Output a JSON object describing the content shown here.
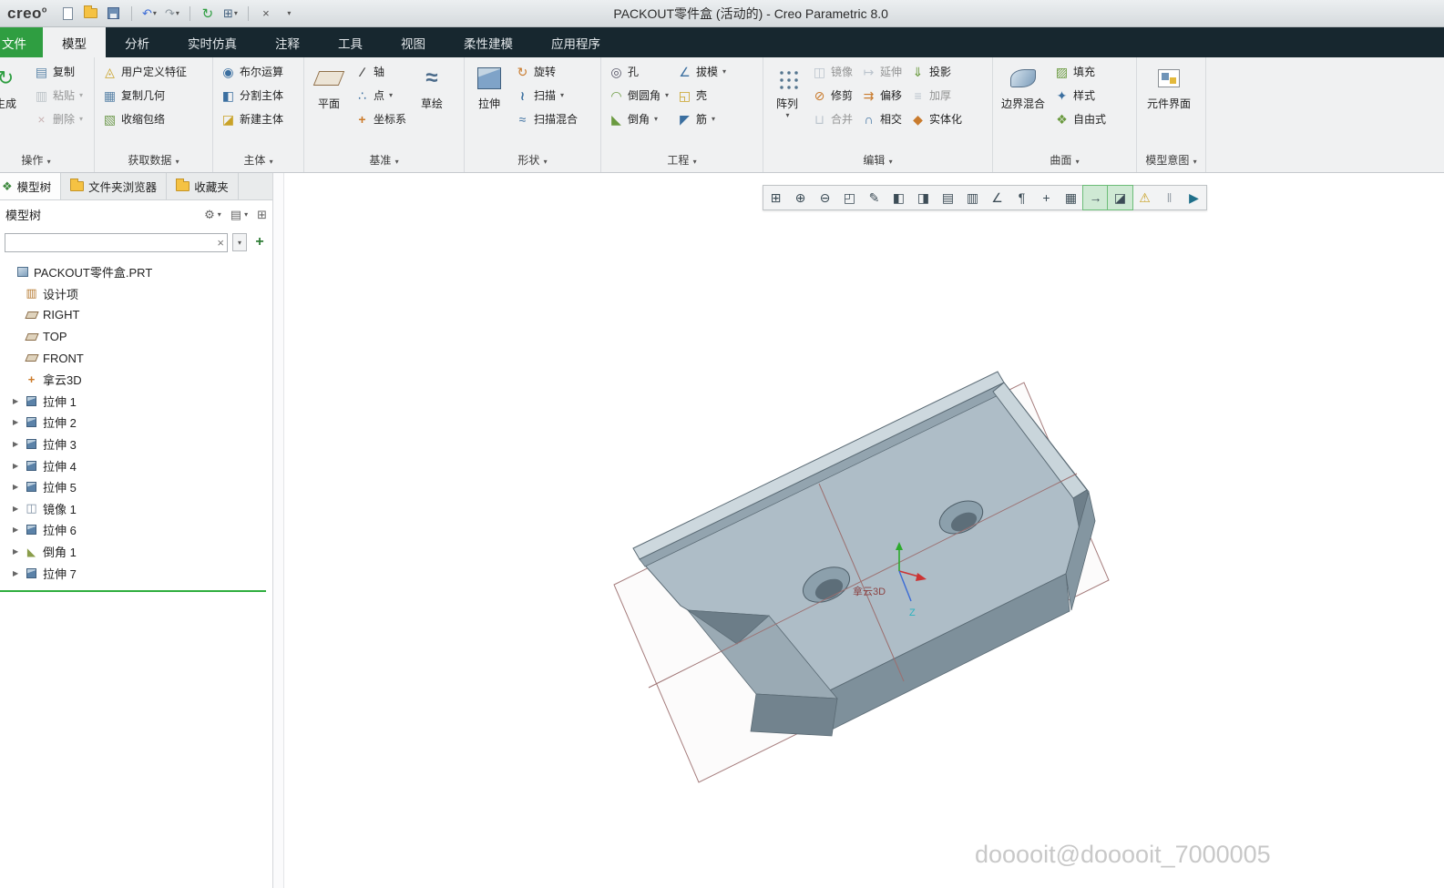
{
  "titlebar": {
    "logo": "creo",
    "title": "PACKOUT零件盒 (活动的) - Creo Parametric 8.0"
  },
  "tabs": {
    "file": "文件",
    "items": [
      "模型",
      "分析",
      "实时仿真",
      "注释",
      "工具",
      "视图",
      "柔性建模",
      "应用程序"
    ],
    "active": "模型"
  },
  "ribbon": {
    "groups": [
      {
        "label": "操作",
        "big": {
          "label": "生成",
          "icon": "regenerate-icon"
        },
        "small": [
          {
            "label": "复制",
            "icon": "copy-icon"
          },
          {
            "label": "粘贴",
            "icon": "paste-icon",
            "dropdown": true,
            "disabled": true
          },
          {
            "label": "删除",
            "icon": "delete-icon",
            "dropdown": true,
            "disabled": true
          }
        ]
      },
      {
        "label": "获取数据",
        "small": [
          {
            "label": "用户定义特征",
            "icon": "udf-icon"
          },
          {
            "label": "复制几何",
            "icon": "copy-geometry-icon"
          },
          {
            "label": "收缩包络",
            "icon": "shrinkwrap-icon"
          }
        ]
      },
      {
        "label": "主体",
        "small": [
          {
            "label": "布尔运算",
            "icon": "boolean-icon"
          },
          {
            "label": "分割主体",
            "icon": "split-body-icon"
          },
          {
            "label": "新建主体",
            "icon": "new-body-icon"
          }
        ]
      },
      {
        "label": "基准",
        "big": {
          "label": "平面",
          "icon": "datum-plane-icon"
        },
        "small": [
          {
            "label": "轴",
            "icon": "axis-icon"
          },
          {
            "label": "点",
            "icon": "point-icon",
            "dropdown": true
          },
          {
            "label": "坐标系",
            "icon": "csys-icon"
          }
        ],
        "big2": {
          "label": "草绘",
          "icon": "sketch-icon"
        }
      },
      {
        "label": "形状",
        "big": {
          "label": "拉伸",
          "icon": "extrude-icon"
        },
        "small": [
          {
            "label": "旋转",
            "icon": "revolve-icon"
          },
          {
            "label": "扫描",
            "icon": "sweep-icon",
            "dropdown": true
          },
          {
            "label": "扫描混合",
            "icon": "swept-blend-icon"
          }
        ]
      },
      {
        "label": "工程",
        "small": [
          {
            "label": "孔",
            "icon": "hole-icon"
          },
          {
            "label": "倒圆角",
            "icon": "round-icon",
            "dropdown": true
          },
          {
            "label": "倒角",
            "icon": "chamfer-icon",
            "dropdown": true
          }
        ],
        "small2": [
          {
            "label": "拔模",
            "icon": "draft-icon",
            "dropdown": true
          },
          {
            "label": "壳",
            "icon": "shell-icon"
          },
          {
            "label": "筋",
            "icon": "rib-icon",
            "dropdown": true
          }
        ]
      },
      {
        "label": "编辑",
        "big": {
          "label": "阵列",
          "icon": "pattern-icon",
          "dropdown": true
        },
        "small": [
          {
            "label": "镜像",
            "icon": "mirror-icon",
            "disabled": true
          },
          {
            "label": "修剪",
            "icon": "trim-icon"
          },
          {
            "label": "合并",
            "icon": "merge-icon",
            "disabled": true
          }
        ],
        "small2": [
          {
            "label": "延伸",
            "icon": "extend-icon",
            "disabled": true
          },
          {
            "label": "偏移",
            "icon": "offset-icon"
          },
          {
            "label": "相交",
            "icon": "intersect-icon"
          }
        ],
        "small3": [
          {
            "label": "投影",
            "icon": "project-icon"
          },
          {
            "label": "加厚",
            "icon": "thicken-icon",
            "disabled": true
          },
          {
            "label": "实体化",
            "icon": "solidify-icon"
          }
        ]
      },
      {
        "label": "曲面",
        "big": {
          "label": "边界混合",
          "icon": "boundary-blend-icon"
        },
        "small": [
          {
            "label": "填充",
            "icon": "fill-icon"
          },
          {
            "label": "样式",
            "icon": "style-icon"
          },
          {
            "label": "自由式",
            "icon": "freestyle-icon"
          }
        ]
      },
      {
        "label": "模型意图",
        "big": {
          "label": "元件界面",
          "icon": "component-interface-icon"
        }
      }
    ]
  },
  "panel": {
    "tabs": [
      {
        "label": "模型树",
        "icon": "model-tree-icon",
        "active": true
      },
      {
        "label": "文件夹浏览器",
        "icon": "folder-browser-icon"
      },
      {
        "label": "收藏夹",
        "icon": "favorites-icon"
      }
    ],
    "tree_header": "模型树",
    "header_icons": [
      "settings-icon",
      "list-options-icon",
      "expand-all-icon"
    ],
    "search": {
      "value": "",
      "clear": "×"
    },
    "items": [
      {
        "label": "PACKOUT零件盒.PRT",
        "icon": "part-icon"
      },
      {
        "label": "设计项",
        "icon": "design-items-icon"
      },
      {
        "label": "RIGHT",
        "icon": "datum-plane-icon"
      },
      {
        "label": "TOP",
        "icon": "datum-plane-icon"
      },
      {
        "label": "FRONT",
        "icon": "datum-plane-icon"
      },
      {
        "label": "拿云3D",
        "icon": "csys-icon"
      },
      {
        "label": "拉伸 1",
        "icon": "extrude-icon"
      },
      {
        "label": "拉伸 2",
        "icon": "extrude-icon"
      },
      {
        "label": "拉伸 3",
        "icon": "extrude-icon"
      },
      {
        "label": "拉伸 4",
        "icon": "extrude-icon"
      },
      {
        "label": "拉伸 5",
        "icon": "extrude-icon"
      },
      {
        "label": "镜像 1",
        "icon": "mirror-icon"
      },
      {
        "label": "拉伸 6",
        "icon": "extrude-icon"
      },
      {
        "label": "倒角 1",
        "icon": "chamfer-icon"
      },
      {
        "label": "拉伸 7",
        "icon": "extrude-icon"
      }
    ]
  },
  "canvas": {
    "toolbar_icons": [
      "zoom-region-icon",
      "zoom-in-icon",
      "zoom-out-icon",
      "refit-icon",
      "repaint-icon",
      "display-style-icon",
      "section-view-icon",
      "saved-views-icon",
      "view-manager-icon",
      "datum-display-filter-icon",
      "annotation-display-icon",
      "spin-center-icon",
      "render-options-icon",
      "drag-components-icon",
      "snap-mode-icon",
      "alerts-icon",
      "pause-icon",
      "resume-icon"
    ],
    "csys_label": "拿云3D",
    "z_label": "Z",
    "watermark": "dooooit@dooooit_7000005"
  }
}
